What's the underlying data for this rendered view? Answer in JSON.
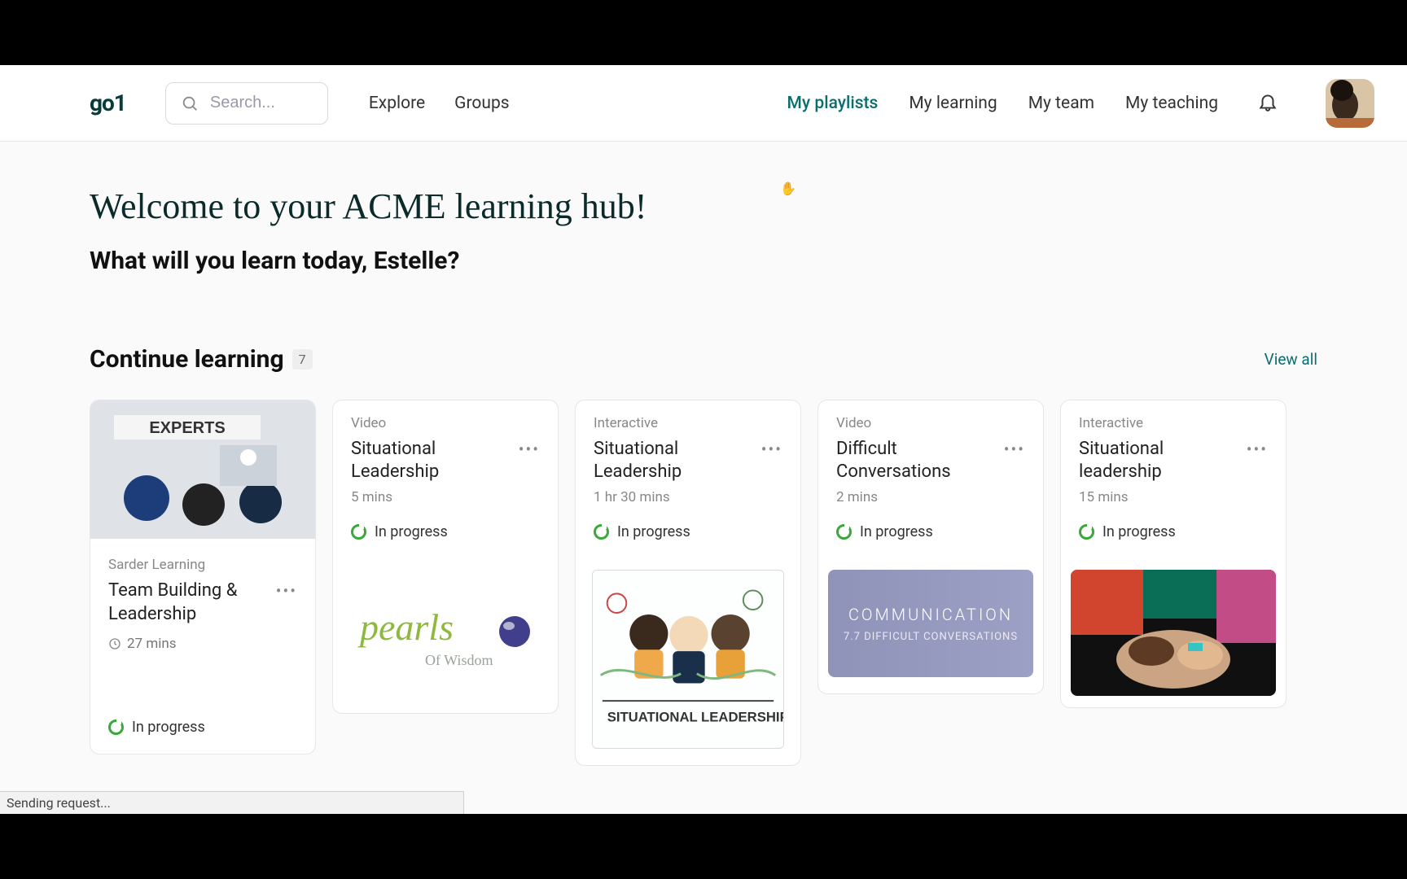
{
  "brand": {
    "logo": "go1"
  },
  "search": {
    "placeholder": "Search..."
  },
  "nav_left": {
    "explore": "Explore",
    "groups": "Groups"
  },
  "nav_right": {
    "my_playlists": "My playlists",
    "my_learning": "My learning",
    "my_team": "My team",
    "my_teaching": "My teaching"
  },
  "welcome": {
    "title": "Welcome to your ACME learning hub!",
    "subtitle": "What will you learn today, Estelle?"
  },
  "continue": {
    "heading": "Continue learning",
    "count": "7",
    "view_all": "View all"
  },
  "cards": [
    {
      "publisher": "Sarder Learning",
      "title": "Team Building & Leadership",
      "duration": "27 mins",
      "status": "In progress",
      "image_label": "EXPERTS"
    },
    {
      "type": "Video",
      "title": "Situational Leadership",
      "duration": "5 mins",
      "status": "In progress",
      "brand_line1": "pearls",
      "brand_line2": "Of Wisdom"
    },
    {
      "type": "Interactive",
      "title": "Situational Leadership",
      "duration": "1 hr 30 mins",
      "status": "In progress",
      "art_caption": "SITUATIONAL LEADERSHIP"
    },
    {
      "type": "Video",
      "title": "Difficult Conversations",
      "duration": "2 mins",
      "status": "In progress",
      "art_line1": "COMMUNICATION",
      "art_line2": "7.7  DIFFICULT CONVERSATIONS"
    },
    {
      "type": "Interactive",
      "title": "Situational leadership",
      "duration": "15 mins",
      "status": "In progress"
    }
  ],
  "statusbar": {
    "text": "Sending request..."
  },
  "colors": {
    "teal": "#0b6e6e",
    "progress_green": "#3aa73a",
    "bg": "#fafafa"
  }
}
